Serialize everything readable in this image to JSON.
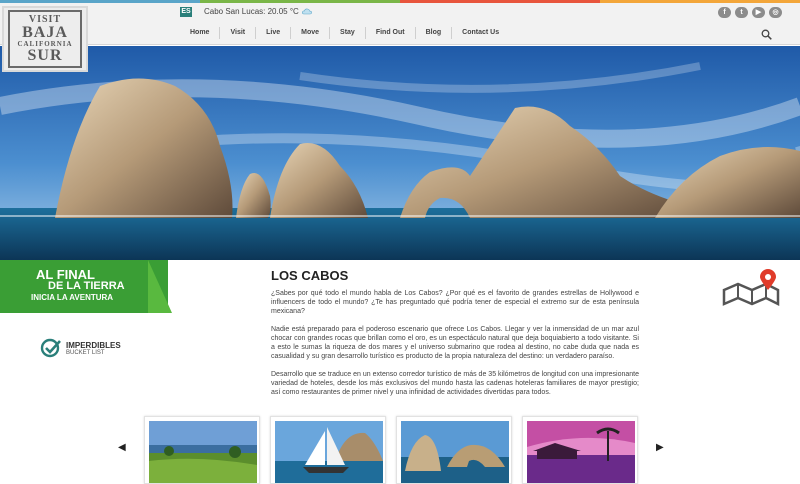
{
  "colors": {
    "green": "#3a9e35",
    "green_light": "#59b93f",
    "nav_bg": "#f2f2f2",
    "stripe": [
      "#5aa5c9",
      "#7ab648",
      "#e8553d",
      "#f3a63a"
    ]
  },
  "logo": {
    "line1": "VISIT",
    "line2": "BAJA",
    "line3": "CALIFORNIA",
    "line4": "SUR"
  },
  "header": {
    "lang": "ES",
    "weather": "Cabo San Lucas: 20.05 °C",
    "weather_icon": "cloud-icon",
    "menu": [
      "Home",
      "Visit",
      "Live",
      "Move",
      "Stay",
      "Find Out",
      "Blog",
      "Contact Us"
    ],
    "social_icons": [
      "facebook-icon",
      "twitter-icon",
      "youtube-icon",
      "instagram-icon"
    ],
    "search_icon": "search-icon"
  },
  "band": {
    "line1": "AL FINAL",
    "line2": "DE LA TIERRA",
    "line3": "INICIA LA AVENTURA"
  },
  "bucket": {
    "title": "IMPERDIBLES",
    "subtitle": "BUCKET LIST"
  },
  "article": {
    "title": "LOS CABOS",
    "p1": "¿Sabes por qué todo el mundo habla de Los Cabos? ¿Por qué es el favorito de grandes estrellas de Hollywood e influencers de todo el mundo? ¿Te has preguntado qué podría tener de especial el extremo sur de esta península mexicana?",
    "p2": "Nadie está preparado para el poderoso escenario que ofrece Los Cabos. Llegar y ver la inmensidad de un mar azul chocar con grandes rocas que brillan como el oro, es un espectáculo natural que deja boquiabierto a todo visitante. Si a esto le sumas la riqueza de dos mares y el universo submarino que rodea al destino, no cabe duda que nada es casualidad y su gran desarrollo turístico es producto de la propia naturaleza del destino: un verdadero paraíso.",
    "p3": "Desarrollo que se traduce en un extenso corredor turístico de más de 35 kilómetros de longitud con una impresionante variedad de hoteles, desde los más exclusivos del mundo hasta las cadenas hoteleras familiares de mayor prestigio; así como restaurantes de primer nivel y una infinidad de actividades divertidas para todos."
  },
  "carousel": {
    "prev_icon": "chevron-left-icon",
    "next_icon": "chevron-right-icon",
    "thumbs": [
      "golf-course-photo",
      "sailboat-photo",
      "arch-rocks-photo",
      "resort-sunset-photo"
    ]
  }
}
